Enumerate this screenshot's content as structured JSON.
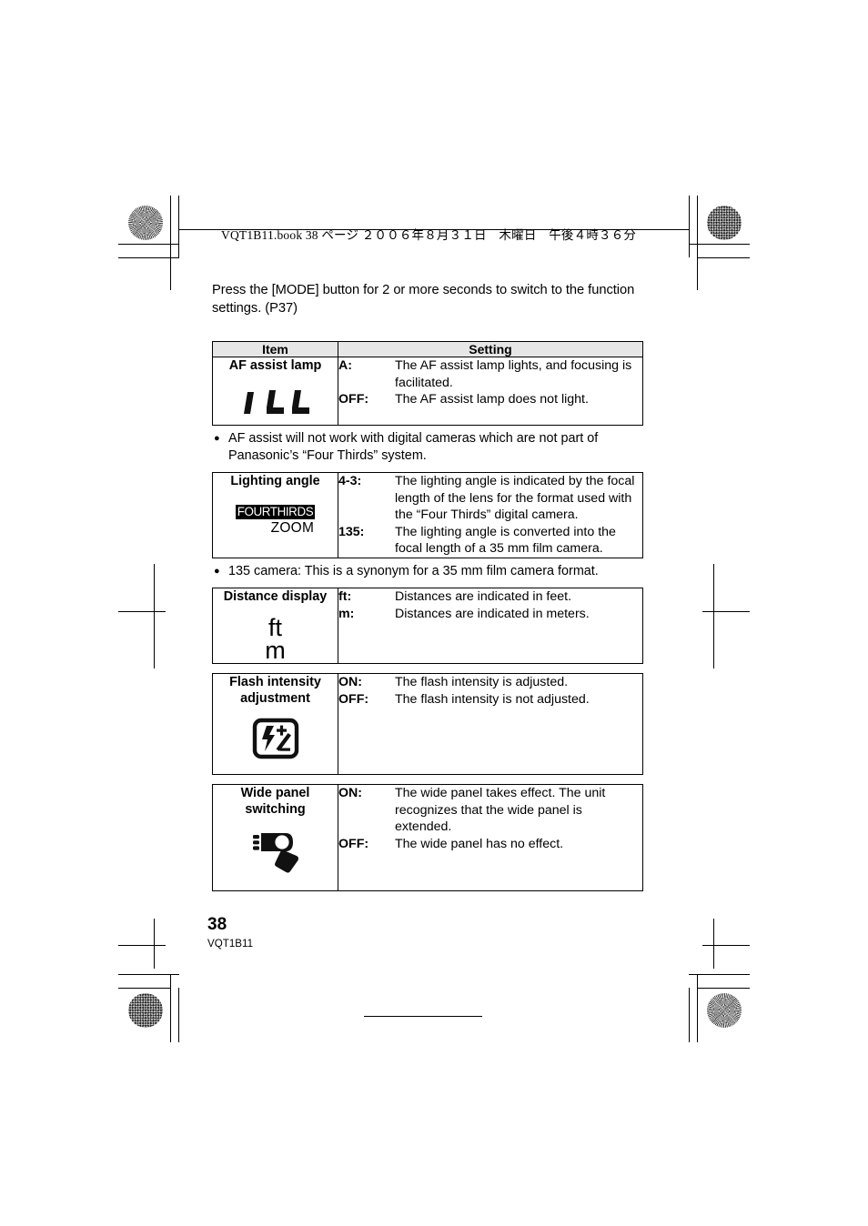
{
  "header": {
    "slug": "VQT1B11.book   38 ページ   ２００６年８月３１日　木曜日　午後４時３６分"
  },
  "intro": {
    "text": "Press the [MODE] button for 2 or more seconds to switch to the function settings. (P37)"
  },
  "table_headers": {
    "item": "Item",
    "setting": "Setting"
  },
  "tables": [
    {
      "id": "af-assist-lamp",
      "has_header": true,
      "item_title": "AF assist lamp",
      "icon_name": "lcd-ill-icon",
      "icon_text": "ILL",
      "settings": [
        {
          "key": "A:",
          "value": "The AF assist lamp lights, and focusing is facilitated."
        },
        {
          "key": "OFF:",
          "value": "The AF assist lamp does not light."
        }
      ]
    },
    {
      "id": "lighting-angle",
      "has_header": false,
      "item_title": "Lighting angle",
      "icon_name": "lcd-fourthirds-zoom-icon",
      "icon_text_primary": "FOURTHIRDS",
      "icon_text_secondary": "ZOOM",
      "settings": [
        {
          "key": "4-3:",
          "value": "The lighting angle is indicated by the focal length of the lens for the format used with the “Four Thirds” digital camera."
        },
        {
          "key": "135:",
          "value": "The lighting angle is converted into the focal length of a 35 mm film camera."
        }
      ]
    },
    {
      "id": "distance-display",
      "has_header": false,
      "item_title": "Distance display",
      "icon_name": "lcd-ft-m-icon",
      "icon_text_primary": "ft",
      "icon_text_secondary": "m",
      "settings": [
        {
          "key": "ft:",
          "value": "Distances are indicated in feet."
        },
        {
          "key": "m:",
          "value": "Distances are indicated in meters."
        }
      ]
    },
    {
      "id": "flash-intensity-adjustment",
      "has_header": false,
      "item_title": "Flash intensity adjustment",
      "icon_name": "flash-intensity-icon",
      "settings": [
        {
          "key": "ON:",
          "value": "The flash intensity is adjusted."
        },
        {
          "key": "OFF:",
          "value": "The flash intensity is not adjusted."
        }
      ]
    },
    {
      "id": "wide-panel-switching",
      "has_header": false,
      "item_title": "Wide panel switching",
      "icon_name": "wide-panel-icon",
      "settings": [
        {
          "key": "ON:",
          "value": "The wide panel takes effect. The unit recognizes that the wide panel is extended."
        },
        {
          "key": "OFF:",
          "value": "The wide panel has no effect."
        }
      ]
    }
  ],
  "notes": [
    {
      "id": "note-af-assist",
      "bullet": "●",
      "text": "AF assist will not work with digital cameras which are not part of Panasonic’s “Four Thirds” system."
    },
    {
      "id": "note-135-camera",
      "bullet": "●",
      "text": "135 camera: This is a synonym for a 35 mm film camera format."
    }
  ],
  "footer": {
    "page_number": "38",
    "doc_code": "VQT1B11"
  },
  "colors": {
    "header_row_bg": "#e6e6e6",
    "rule": "#000000",
    "page_bg": "#ffffff"
  }
}
